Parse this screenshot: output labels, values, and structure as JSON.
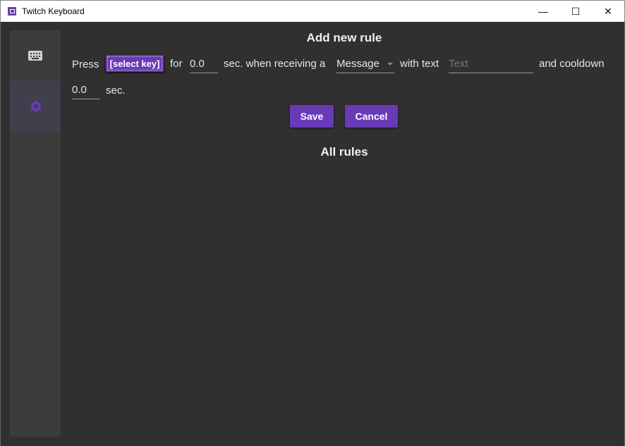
{
  "window": {
    "title": "Twitch Keyboard",
    "minimize": "—",
    "maximize": "☐",
    "close": "✕"
  },
  "sidebar": {
    "items": [
      {
        "icon": "keyboard-icon"
      },
      {
        "icon": "gear-icon",
        "active": true
      }
    ]
  },
  "form": {
    "heading": "Add new rule",
    "press": "Press",
    "select_key": "[select key]",
    "for": "for",
    "duration": "0.0",
    "when_receiving": "sec. when receiving a",
    "event_type": "Message",
    "with_text": "with text",
    "text_placeholder": "Text",
    "and_cooldown": "and cooldown",
    "cooldown": "0.0",
    "sec": "sec.",
    "save": "Save",
    "cancel": "Cancel"
  },
  "rules": {
    "heading": "All rules"
  },
  "colors": {
    "accent": "#673ab7",
    "background": "#303030"
  }
}
